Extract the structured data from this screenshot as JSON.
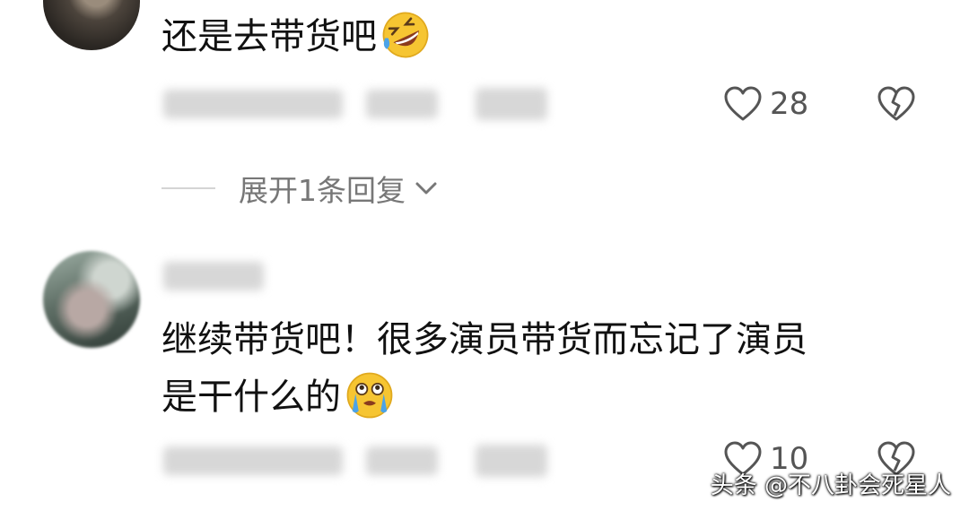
{
  "comments": [
    {
      "text": "还是去带货吧",
      "emoji": "rolling-on-floor-laughing-emoji",
      "likes": "28"
    },
    {
      "text_line1": "继续带货吧！很多演员带货而忘记了演员",
      "text_line2": "是干什么的",
      "emoji": "crying-emoji",
      "likes": "10"
    }
  ],
  "expand_replies_label": "展开1条回复",
  "icons": {
    "like": "heart-icon",
    "dislike": "broken-heart-icon",
    "expand": "chevron-down-icon"
  },
  "watermark": "头条 @不八卦会死星人",
  "colors": {
    "text": "#111111",
    "meta": "#555555",
    "expand_text": "#777777",
    "emoji_face": "#F6C532"
  }
}
